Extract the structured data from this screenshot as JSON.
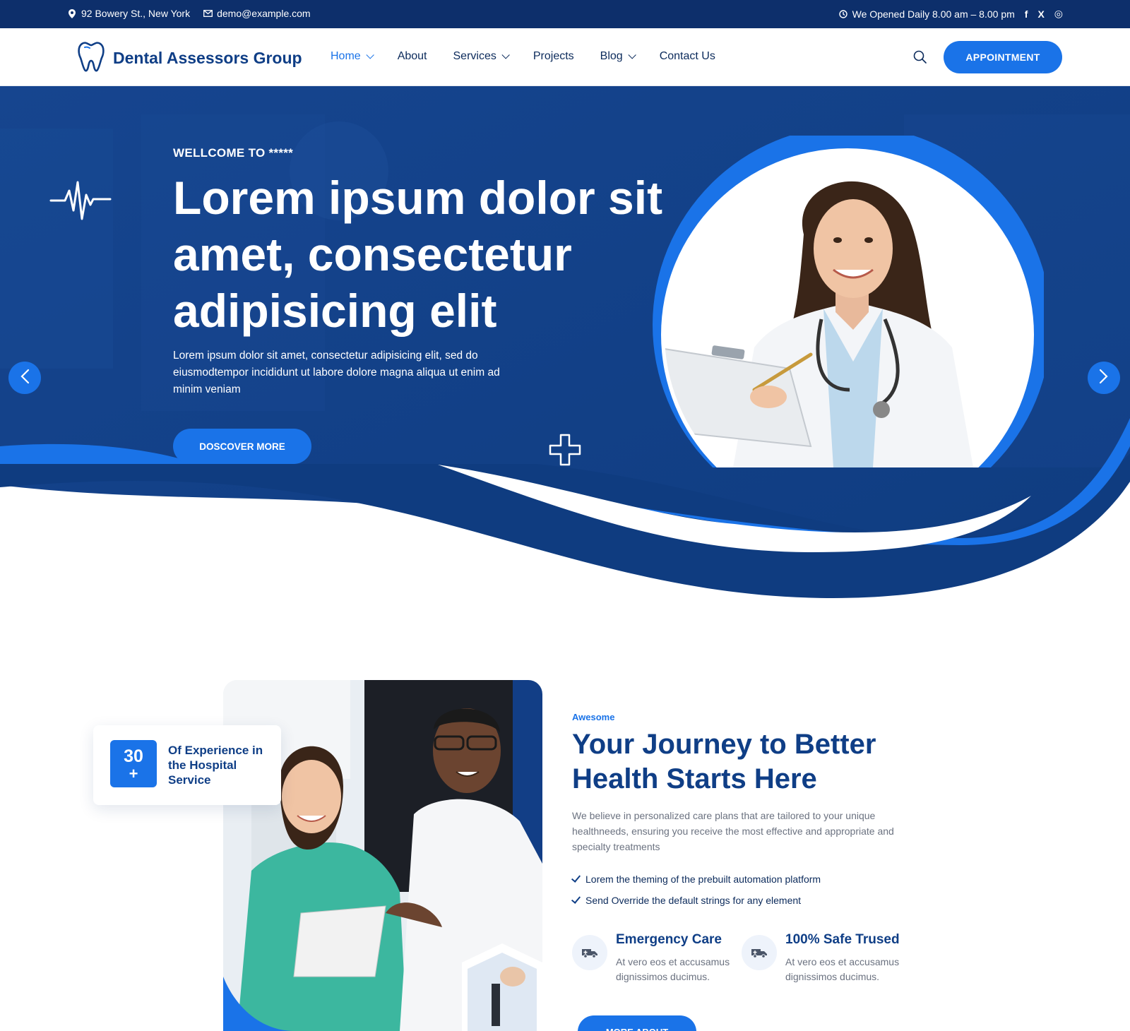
{
  "topbar": {
    "address": "92 Bowery St., New York",
    "email": "demo@example.com",
    "hours": "We Opened Daily 8.00 am – 8.00 pm",
    "social": [
      "f",
      "X",
      "◎"
    ]
  },
  "header": {
    "brand": "Dental Assessors Group",
    "nav": [
      {
        "label": "Home",
        "dropdown": true,
        "active": true
      },
      {
        "label": "About",
        "dropdown": false,
        "active": false
      },
      {
        "label": "Services",
        "dropdown": true,
        "active": false
      },
      {
        "label": "Projects",
        "dropdown": false,
        "active": false
      },
      {
        "label": "Blog",
        "dropdown": true,
        "active": false
      },
      {
        "label": "Contact Us",
        "dropdown": false,
        "active": false
      }
    ],
    "cta": "APPOINTMENT"
  },
  "hero": {
    "eyebrow": "WELLCOME TO *****",
    "title": "Lorem ipsum dolor sit amet, consectetur adipisicing elit",
    "subtitle": "Lorem ipsum dolor sit amet, consectetur adipisicing elit, sed do eiusmodtempor incididunt ut labore dolore magna aliqua ut enim ad minim veniam",
    "button": "DOSCOVER MORE"
  },
  "about": {
    "experience_number": "30",
    "experience_plus": "+",
    "experience_text": "Of Experience in the Hospital Service",
    "tag": "Awesome",
    "title": "Your Journey to Better Health Starts Here",
    "description": "We believe in personalized care plans that are tailored to your unique healthneeds, ensuring you receive the most effective and appropriate and specialty treatments",
    "checks": [
      "Lorem the theming of the prebuilt automation platform",
      "Send Override the default strings for any element"
    ],
    "features": [
      {
        "title": "Emergency Care",
        "text": "At vero eos et accusamus dignissimos ducimus.",
        "icon": "ambulance-icon"
      },
      {
        "title": "100% Safe Trused",
        "text": "At vero eos et accusamus dignissimos ducimus.",
        "icon": "ambulance-icon"
      }
    ],
    "button": "MORE ABOUT"
  },
  "colors": {
    "navy": "#0d2f6b",
    "brand": "#0f3e86",
    "accent": "#1a73e8",
    "hero_bg": "#124592"
  }
}
